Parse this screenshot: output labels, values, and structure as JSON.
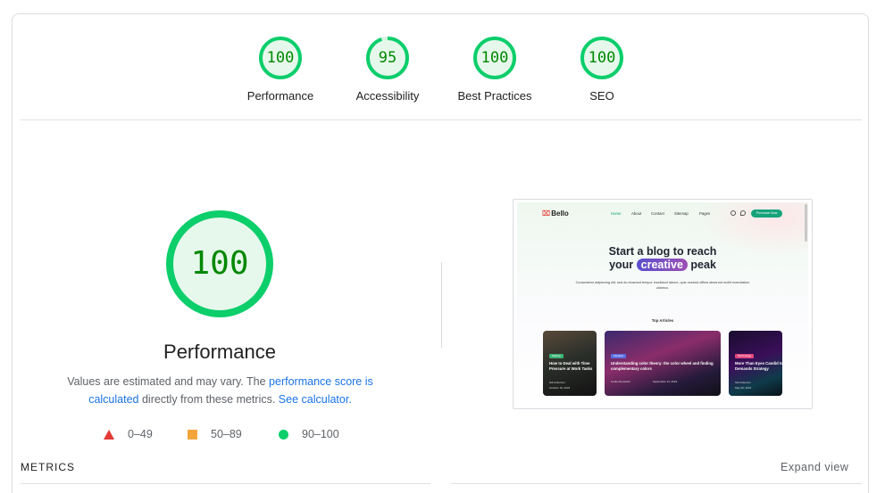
{
  "categories": [
    {
      "label": "Performance",
      "score": "100",
      "value": 100
    },
    {
      "label": "Accessibility",
      "score": "95",
      "value": 95
    },
    {
      "label": "Best Practices",
      "score": "100",
      "value": 100
    },
    {
      "label": "SEO",
      "score": "100",
      "value": 100
    }
  ],
  "performance": {
    "score": "100",
    "value": 100,
    "title": "Performance",
    "desc_prefix": "Values are estimated and may vary. The ",
    "desc_link1": "performance score is calculated",
    "desc_middle": " directly from these metrics. ",
    "desc_link2": "See calculator."
  },
  "legend": [
    {
      "range": "0–49",
      "shape": "triangle",
      "color": "#e53935"
    },
    {
      "range": "50–89",
      "shape": "square",
      "color": "#f4a53a"
    },
    {
      "range": "90–100",
      "shape": "circle",
      "color": "#0cce6b"
    }
  ],
  "metrics": {
    "heading": "METRICS",
    "expand_label": "Expand view"
  },
  "colors": {
    "pass_ring": "#0cce6b",
    "pass_fill": "#e6f8ec",
    "pass_text": "#008800",
    "link": "#1a73e8"
  },
  "screenshot": {
    "logo": "Bello",
    "nav": [
      "Home",
      "About",
      "Contact",
      "Sitemap",
      "Pages"
    ],
    "cta": "Purchase Now",
    "hero_line1": "Start a blog to reach",
    "hero_pre": "your",
    "hero_highlight": "creative",
    "hero_post": "peak",
    "subtitle": "Consectetur adipiscing elit, sed do eiusmod tempor incididunt labore, quis nostrud officia deserunt mollit exercitation ullamco.",
    "section_title": "Top Articles",
    "articles": [
      {
        "badge": "Startup",
        "title": "How to Deal with Time Pressure at Work Tasks",
        "author": "Gill Anderson",
        "date": "October 18, 2023"
      },
      {
        "badge": "Lifestyle",
        "title": "Understanding color theory: the color wheel and finding complementary colors",
        "author": "Leslie Alexander",
        "date": "September 14, 2024"
      },
      {
        "badge": "Technology",
        "title": "More Than Eyes Candid to Demands Strategy",
        "author": "Gill Anderson",
        "date": "May 20, 2024"
      }
    ]
  }
}
